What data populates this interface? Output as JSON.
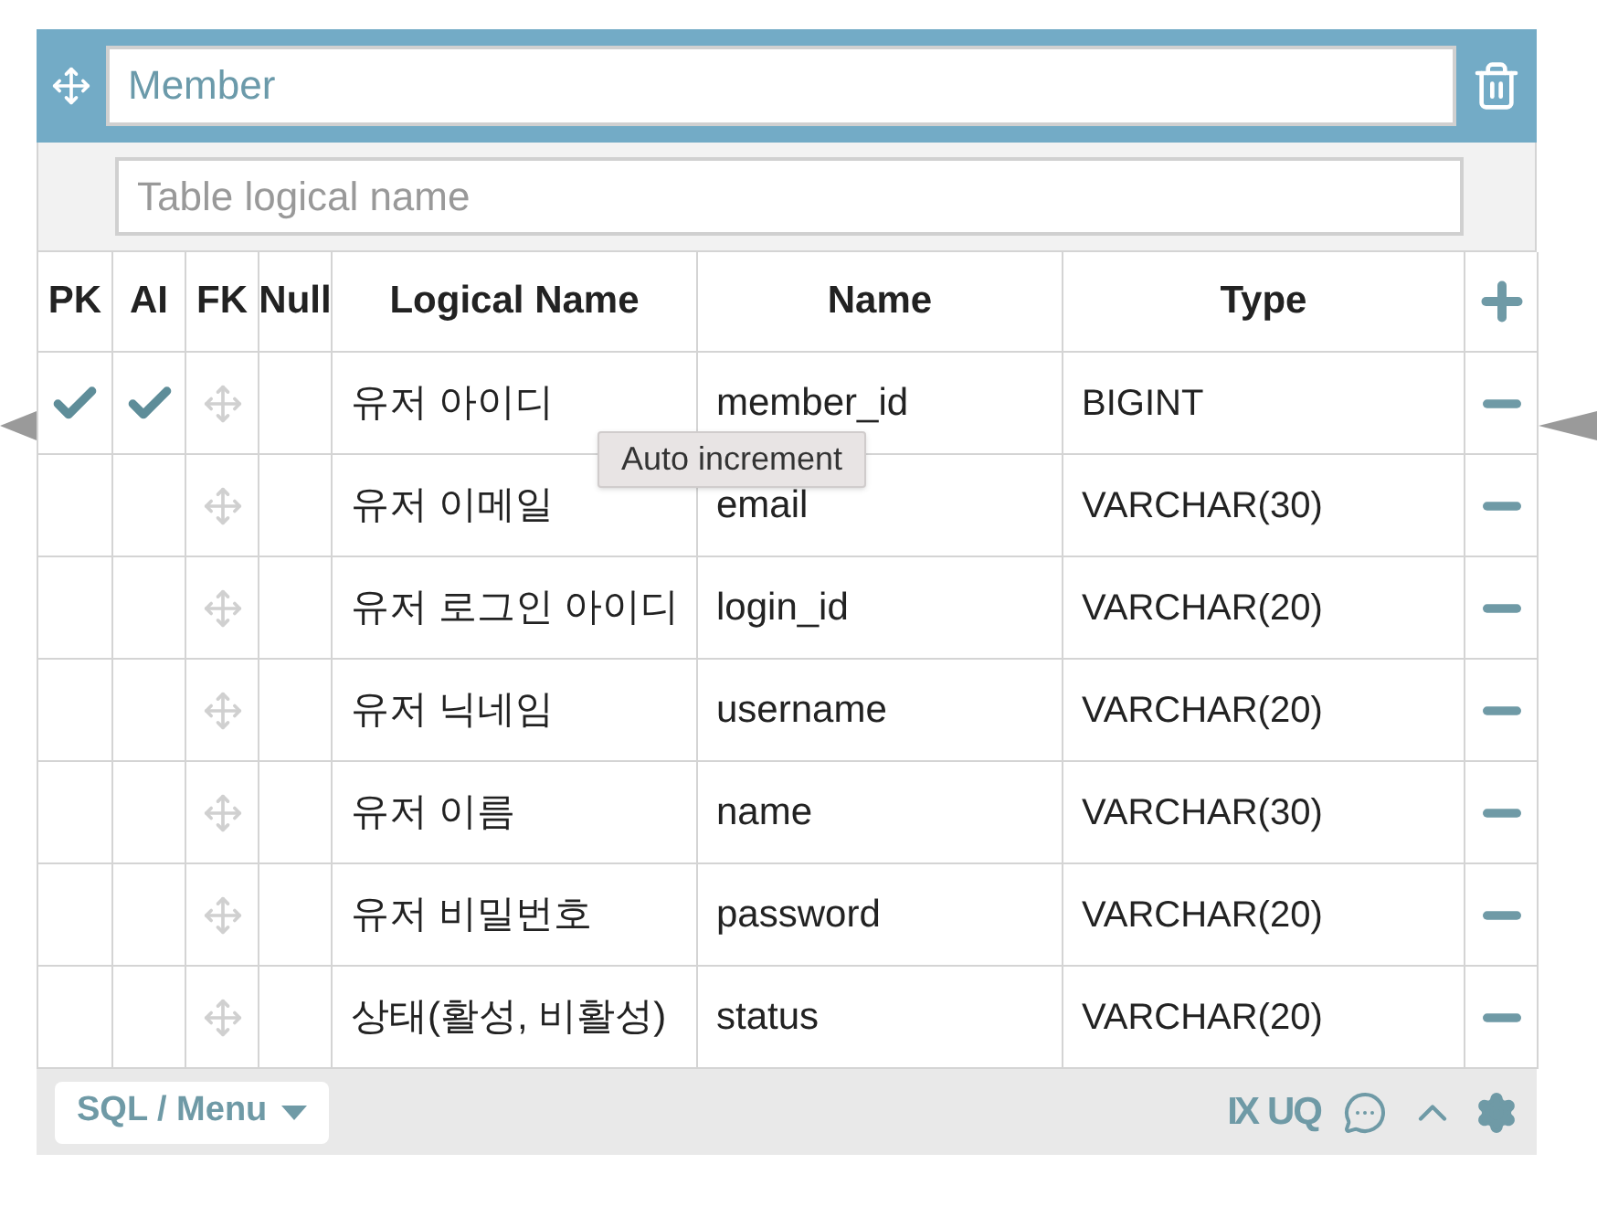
{
  "table": {
    "name": "Member",
    "logical_name_placeholder": "Table logical name",
    "columns": [
      "PK",
      "AI",
      "FK",
      "Null",
      "Logical Name",
      "Name",
      "Type"
    ],
    "rows": [
      {
        "pk": true,
        "ai": true,
        "null": false,
        "logical": "유저 아이디",
        "name": "member_id",
        "type": "BIGINT"
      },
      {
        "pk": false,
        "ai": false,
        "null": false,
        "logical": "유저 이메일",
        "name": "email",
        "type": "VARCHAR(30)"
      },
      {
        "pk": false,
        "ai": false,
        "null": false,
        "logical": "유저 로그인 아이디",
        "name": "login_id",
        "type": "VARCHAR(20)"
      },
      {
        "pk": false,
        "ai": false,
        "null": false,
        "logical": "유저 닉네임",
        "name": "username",
        "type": "VARCHAR(20)"
      },
      {
        "pk": false,
        "ai": false,
        "null": false,
        "logical": "유저 이름",
        "name": "name",
        "type": "VARCHAR(30)"
      },
      {
        "pk": false,
        "ai": false,
        "null": false,
        "logical": "유저 비밀번호",
        "name": "password",
        "type": "VARCHAR(20)"
      },
      {
        "pk": false,
        "ai": false,
        "null": false,
        "logical": "상태(활성, 비활성)",
        "name": "status",
        "type": "VARCHAR(20)"
      }
    ]
  },
  "tooltip": "Auto increment",
  "footer": {
    "menu": "SQL / Menu",
    "index_label": "IX",
    "unique_label": "UQ"
  }
}
